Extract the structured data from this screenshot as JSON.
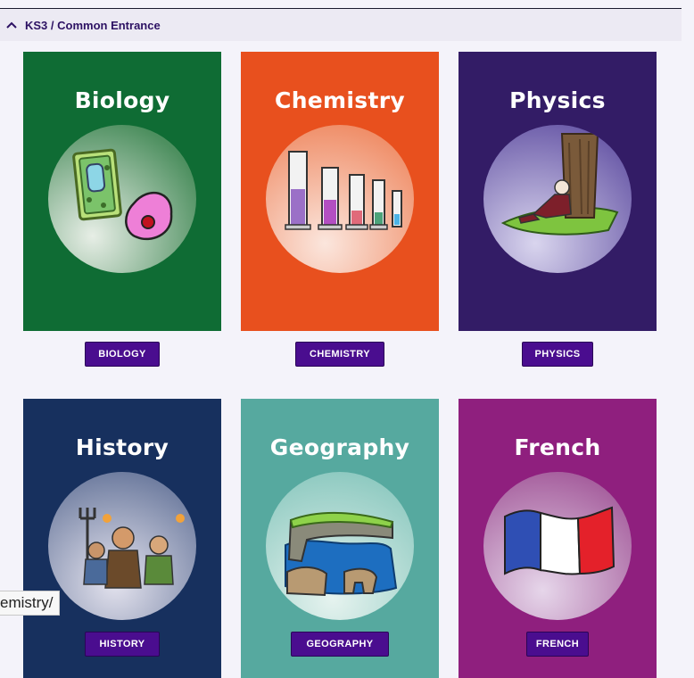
{
  "section": {
    "title": "KS3 / Common Entrance",
    "toggle_icon": "chevron-up-icon"
  },
  "subjects": [
    {
      "title": "Biology",
      "button": "BIOLOGY",
      "color": "#0f6c34",
      "illustration": "plant-and-animal-cell-icon"
    },
    {
      "title": "Chemistry",
      "button": "CHEMISTRY",
      "color": "#e8501e",
      "illustration": "measuring-cylinders-icon"
    },
    {
      "title": "Physics",
      "button": "PHYSICS",
      "color": "#331c66",
      "illustration": "newton-under-tree-icon"
    },
    {
      "title": "History",
      "button": "HISTORY",
      "color": "#17305e",
      "illustration": "angry-mob-icon"
    },
    {
      "title": "Geography",
      "button": "GEOGRAPHY",
      "color": "#56a99f",
      "illustration": "coastal-cliffs-icon"
    },
    {
      "title": "French",
      "button": "FRENCH",
      "color": "#8f1f7e",
      "illustration": "french-flag-icon"
    }
  ],
  "status_bar": {
    "url": "emistry/"
  },
  "colors": {
    "button_bg": "#4a0d8f",
    "header_text": "#2d1263",
    "page_bg": "#f4f3fa"
  }
}
